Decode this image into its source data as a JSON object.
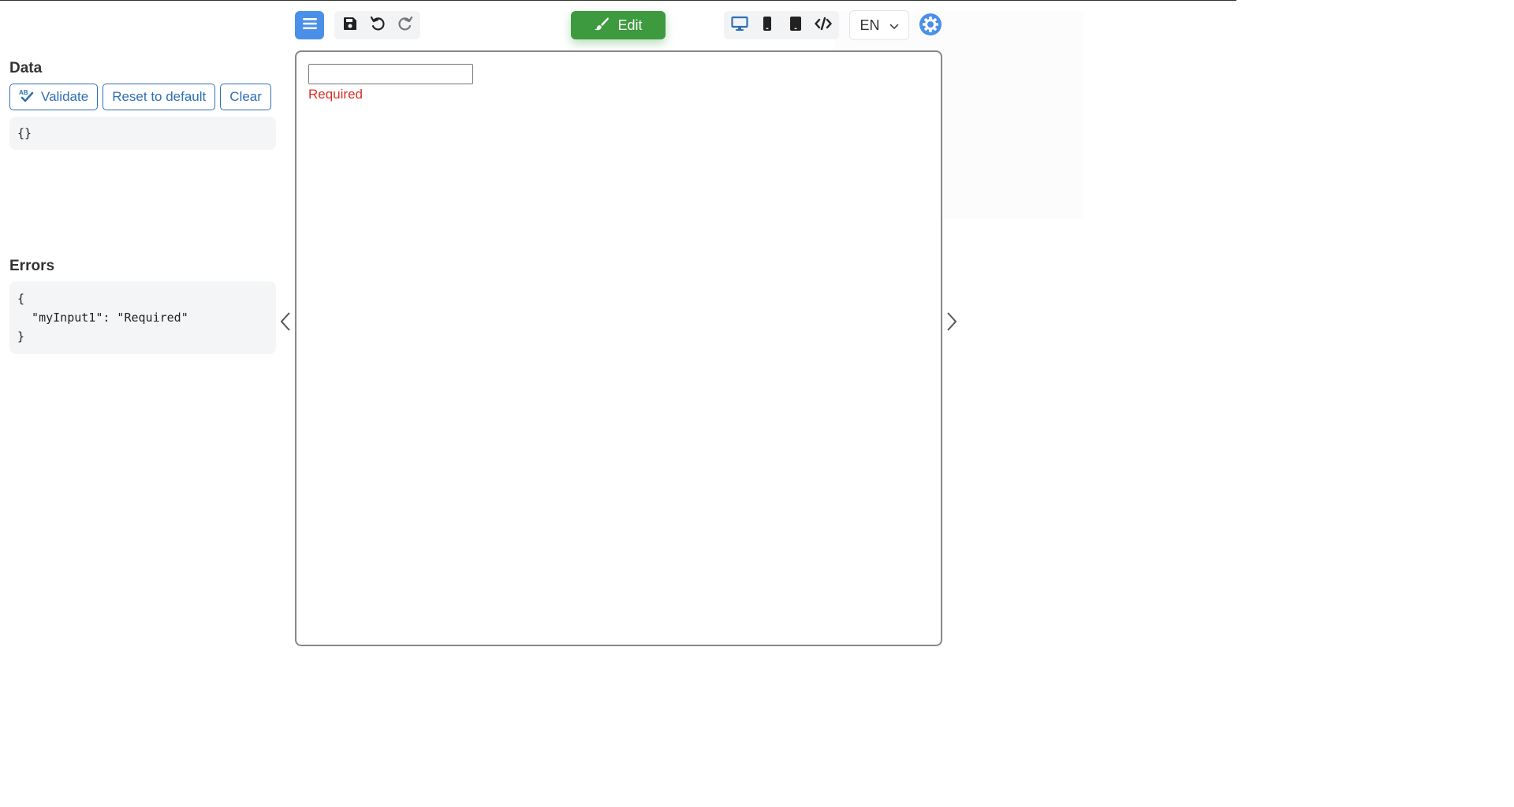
{
  "data_panel": {
    "title": "Data",
    "buttons": {
      "validate": "Validate",
      "reset": "Reset to default",
      "clear": "Clear"
    },
    "json": "{}"
  },
  "errors_panel": {
    "title": "Errors",
    "json": "{\n  \"myInput1\": \"Required\"\n}"
  },
  "toolbar": {
    "edit_label": "Edit",
    "language": "EN"
  },
  "form": {
    "input_value": "",
    "error_text": "Required"
  },
  "colors": {
    "accent": "#4a90e8",
    "edit_green": "#3d9a3f",
    "error_red": "#d93025",
    "link_blue": "#2f6fb3"
  },
  "icons": [
    "hamburger-icon",
    "save-icon",
    "undo-icon",
    "redo-icon",
    "paintbrush-icon",
    "desktop-icon",
    "mobile-icon",
    "tablet-icon",
    "code-icon",
    "chevron-down-icon",
    "gear-icon",
    "spellcheck-icon",
    "chevron-left-icon",
    "chevron-right-icon"
  ]
}
